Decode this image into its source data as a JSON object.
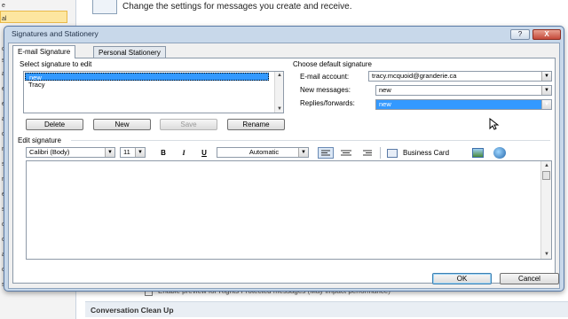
{
  "background": {
    "header_text": "Change the settings for messages you create and receive.",
    "left_items": [
      "e",
      "al",
      "ct",
      "s",
      "a",
      "er",
      "e",
      "al",
      "ct",
      "ns",
      "ss",
      "n",
      "er",
      "s",
      "ol",
      "c",
      "ar",
      "ce",
      "s"
    ],
    "checkbox_label": "Enable preview for Rights Protected messages (May impact performance)",
    "section_title": "Conversation Clean Up"
  },
  "dialog": {
    "title": "Signatures and Stationery",
    "help_label": "?",
    "close_label": "X",
    "tabs": [
      {
        "label": "E-mail Signature",
        "selected": true
      },
      {
        "label": "Personal Stationery",
        "selected": false
      }
    ],
    "select_signature_label": "Select signature to edit",
    "signatures": [
      "new",
      "Tracy"
    ],
    "selected_signature": "new",
    "buttons": {
      "delete": "Delete",
      "new": "New",
      "save": "Save",
      "rename": "Rename"
    },
    "default_signature": {
      "heading": "Choose default signature",
      "email_account_label": "E-mail account:",
      "email_account_value": "tracy.mcquoid@granderie.ca",
      "new_messages_label": "New messages:",
      "new_messages_value": "new",
      "replies_label": "Replies/forwards:",
      "replies_value": "new"
    },
    "edit_signature_label": "Edit signature",
    "toolbar": {
      "font": "Calibri (Body)",
      "size": "11",
      "bold": "B",
      "italic": "I",
      "underline": "U",
      "color": "Automatic",
      "business_card": "Business Card"
    },
    "ok_label": "OK",
    "cancel_label": "Cancel"
  },
  "colors": {
    "selection": "#3399ff",
    "dialog_frame": "#c8d8ea",
    "nav_highlight": "#fde6a0"
  }
}
